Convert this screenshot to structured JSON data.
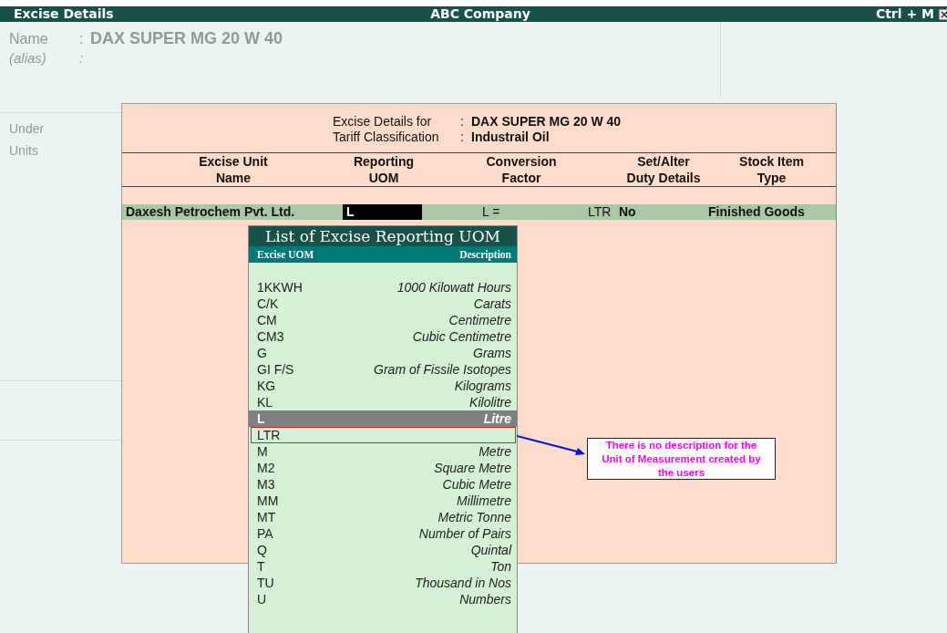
{
  "header": {
    "title": "Excise Details",
    "company": "ABC Company",
    "shortcut": "Ctrl + M"
  },
  "background_form": {
    "fields": [
      {
        "label": "Name",
        "separator": ":",
        "value": "DAX SUPER MG 20 W 40"
      },
      {
        "label": "(alias)",
        "separator": ":"
      }
    ],
    "labels": [
      "Under",
      "Units"
    ]
  },
  "excise_panel": {
    "info": [
      {
        "label": "Excise Details for",
        "separator": ":",
        "value": "DAX SUPER MG 20 W 40"
      },
      {
        "label": "Tariff Classification",
        "separator": ":",
        "value": "Industrail Oil"
      }
    ],
    "columns": [
      [
        "Excise Unit",
        "Name"
      ],
      [
        "Reporting",
        "UOM"
      ],
      [
        "Conversion",
        "Factor"
      ],
      [
        "Set/Alter",
        "Duty Details"
      ],
      [
        "Stock Item",
        "Type"
      ]
    ],
    "rows": [
      {
        "unit_name": "Daxesh Petrochem Pvt. Ltd.",
        "reporting_uom": "L",
        "conversion_from": "L =",
        "conversion_to": "LTR",
        "duty_details": "No",
        "stock_item_type": "Finished Goods"
      }
    ]
  },
  "uom_list": {
    "title": "List of Excise Reporting UOM",
    "columns": [
      "Excise UOM",
      "Description"
    ],
    "items": [
      {
        "code": "1KKWH",
        "description": "1000 Kilowatt Hours",
        "selected": false,
        "outlined": false
      },
      {
        "code": "C/K",
        "description": "Carats",
        "selected": false,
        "outlined": false
      },
      {
        "code": "CM",
        "description": "Centimetre",
        "selected": false,
        "outlined": false
      },
      {
        "code": "CM3",
        "description": "Cubic Centimetre",
        "selected": false,
        "outlined": false
      },
      {
        "code": "G",
        "description": "Grams",
        "selected": false,
        "outlined": false
      },
      {
        "code": "GI F/S",
        "description": "Gram of Fissile Isotopes",
        "selected": false,
        "outlined": false
      },
      {
        "code": "KG",
        "description": "Kilograms",
        "selected": false,
        "outlined": false
      },
      {
        "code": "KL",
        "description": "Kilolitre",
        "selected": false,
        "outlined": false
      },
      {
        "code": "L",
        "description": "Litre",
        "selected": true,
        "outlined": false
      },
      {
        "code": "LTR",
        "selected": false,
        "outlined": true
      },
      {
        "code": "M",
        "description": "Metre",
        "selected": false,
        "outlined": false
      },
      {
        "code": "M2",
        "description": "Square Metre",
        "selected": false,
        "outlined": false
      },
      {
        "code": "M3",
        "description": "Cubic Metre",
        "selected": false,
        "outlined": false
      },
      {
        "code": "MM",
        "description": "Millimetre",
        "selected": false,
        "outlined": false
      },
      {
        "code": "MT",
        "description": "Metric Tonne",
        "selected": false,
        "outlined": false
      },
      {
        "code": "PA",
        "description": "Number of Pairs",
        "selected": false,
        "outlined": false
      },
      {
        "code": "Q",
        "description": "Quintal",
        "selected": false,
        "outlined": false
      },
      {
        "code": "T",
        "description": "Ton",
        "selected": false,
        "outlined": false
      },
      {
        "code": "TU",
        "description": "Thousand in Nos",
        "selected": false,
        "outlined": false
      },
      {
        "code": "U",
        "description": "Numbers",
        "selected": false,
        "outlined": false
      }
    ]
  },
  "callout": {
    "text": "There is no description for the Unit of Measurement created by the users"
  }
}
